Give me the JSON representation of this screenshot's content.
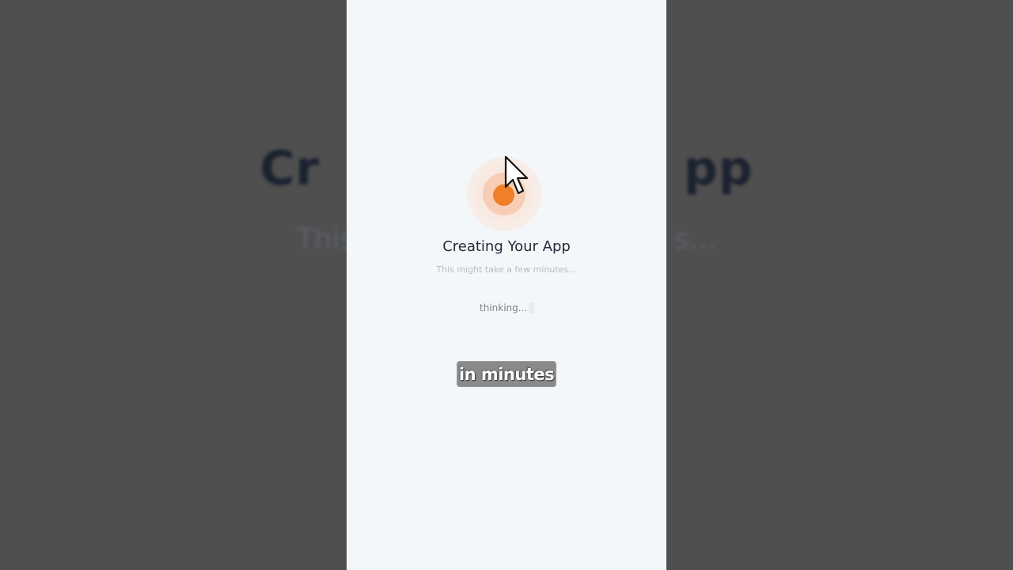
{
  "background": {
    "title_fragment_left": "Cr",
    "title_fragment_right": "pp",
    "subtitle_fragment_left": "This",
    "subtitle_fragment_right": "s..."
  },
  "panel": {
    "title": "Creating Your App",
    "subtitle": "This might take a few minutes...",
    "status": "thinking...",
    "accent_color": "#f07f2a"
  },
  "caption": {
    "text": "in minutes"
  },
  "icons": {
    "loader": "loading-pulse-icon",
    "pointer": "mouse-pointer-icon"
  }
}
